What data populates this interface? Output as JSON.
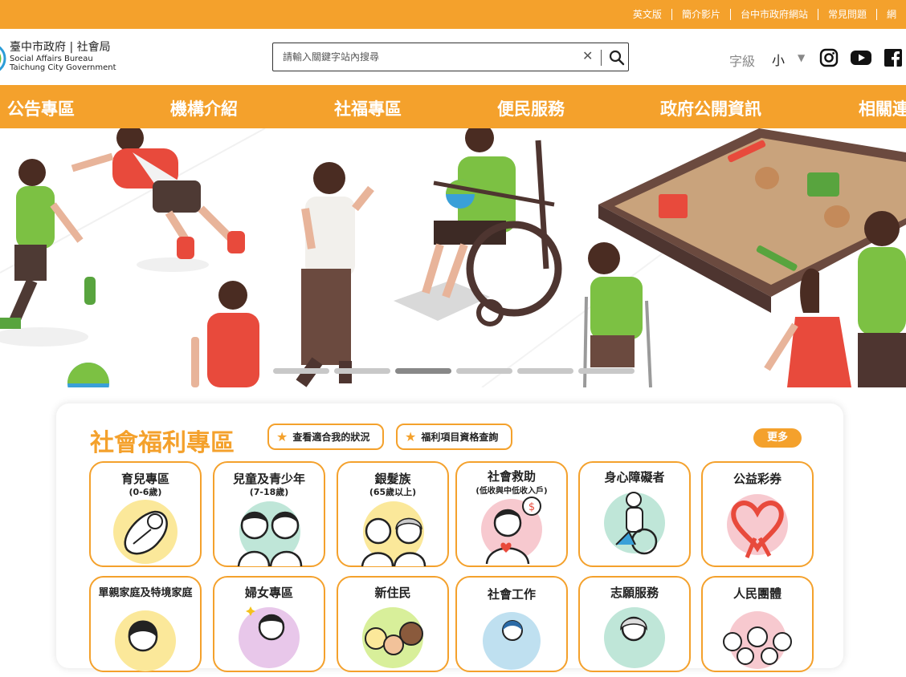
{
  "colors": {
    "accent": "#f4a12c",
    "white": "#ffffff",
    "text": "#222222"
  },
  "top_links": [
    "英文版",
    "簡介影片",
    "台中市政府網站",
    "常見問題",
    "網"
  ],
  "logo": {
    "title": "臺中市政府 | 社會局",
    "en_line1": "Social Affairs Bureau",
    "en_line2": "Taichung City Government"
  },
  "search": {
    "placeholder": "請輸入關鍵字站內搜尋",
    "clear_icon": "close-icon",
    "submit_icon": "search-icon"
  },
  "font_size": {
    "label": "字級",
    "value": "小"
  },
  "social_icons": [
    "instagram-icon",
    "youtube-icon",
    "facebook-icon"
  ],
  "nav": [
    "公告專區",
    "機構介紹",
    "社福專區",
    "便民服務",
    "政府公開資訊",
    "相關連"
  ],
  "carousel": {
    "slide_count": 6,
    "active_index": 2
  },
  "welfare": {
    "title": "社會福利專區",
    "button_status": "查看適合我的狀況",
    "button_query": "福利項目資格查詢",
    "more": "更多"
  },
  "cards": [
    {
      "title": "育兒專區",
      "subtitle": "(0-6歲)"
    },
    {
      "title": "兒童及青少年",
      "subtitle": "(7-18歲)"
    },
    {
      "title": "銀髮族",
      "subtitle": "(65歲以上)"
    },
    {
      "title": "社會救助",
      "subtitle": "(低收與中低收入戶)"
    },
    {
      "title": "身心障礙者",
      "subtitle": ""
    },
    {
      "title": "公益彩券",
      "subtitle": ""
    },
    {
      "title": "單親家庭及特境家庭",
      "subtitle": ""
    },
    {
      "title": "婦女專區",
      "subtitle": ""
    },
    {
      "title": "新住民",
      "subtitle": ""
    },
    {
      "title": "社會工作",
      "subtitle": ""
    },
    {
      "title": "志願服務",
      "subtitle": ""
    },
    {
      "title": "人民團體",
      "subtitle": ""
    }
  ]
}
